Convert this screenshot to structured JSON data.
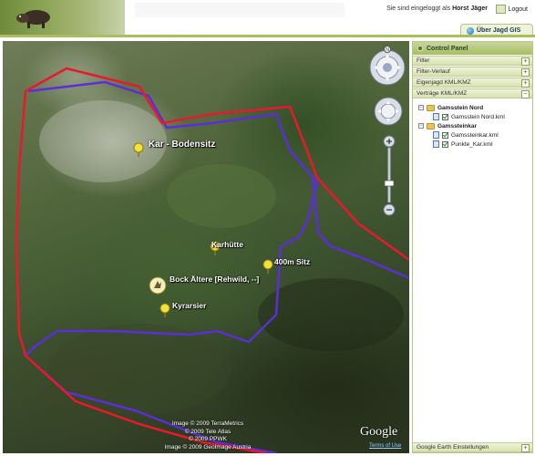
{
  "header": {
    "login_prefix": "Sie sind eingeloggt als",
    "user_name": "Horst Jäger",
    "logout_label": "Logout",
    "tab_label": "Über Jagd GIS"
  },
  "map": {
    "placemarks": [
      {
        "label": "Kar - Bodensitz"
      },
      {
        "label": "Karhütte"
      },
      {
        "label": "400m Sitz"
      },
      {
        "label": "Bock Ältere [Rehwild, --]"
      },
      {
        "label": "Kyrarsier"
      }
    ],
    "copyright": [
      "Image © 2009 TerraMetrics",
      "© 2009 Tele Atlas",
      "© 2009 PPWK",
      "Image © 2009 GeoImage Austria"
    ],
    "logo_text": "Google",
    "terms_link": "Terms of Use",
    "compass_letter": "N",
    "boundary_colors": {
      "red": "#e8192c",
      "blue": "#5a2fd6"
    }
  },
  "panel": {
    "title": "Control Panel",
    "sections": [
      {
        "label": "Filter",
        "toggle": "+"
      },
      {
        "label": "Filter-Verlauf",
        "toggle": "+"
      },
      {
        "label": "Eigenjagd KML/KMZ",
        "toggle": "+"
      },
      {
        "label": "Verträge KML/KMZ",
        "toggle": "−"
      }
    ],
    "tree": [
      {
        "folder": "Gamsstein Nord",
        "expander": "−",
        "files": [
          "Gamsstein Nord.kml"
        ]
      },
      {
        "folder": "Gamssteinkar",
        "expander": "−",
        "files": [
          "Gamssteinkar.kml",
          "Punkte_Kar.kml"
        ]
      }
    ],
    "bottom_section": {
      "label": "Google Earth Einstellungen",
      "toggle": "+"
    }
  }
}
